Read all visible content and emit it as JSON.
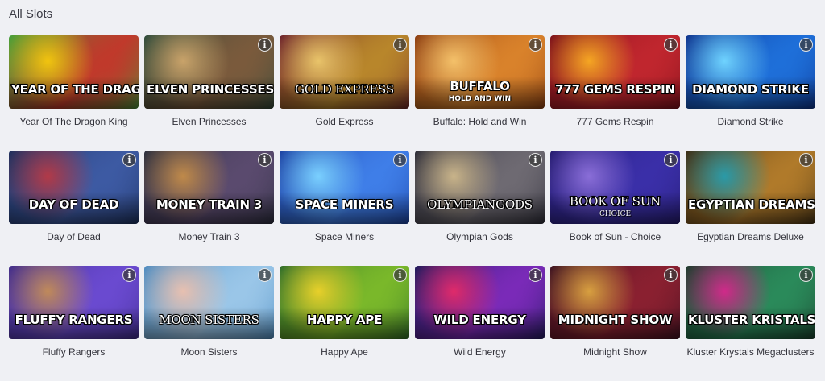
{
  "section": {
    "title": "All Slots"
  },
  "info_icon": "info-icon",
  "games": [
    {
      "name": "Year Of The Dragon King",
      "art": "YEAR OF THE DRAGON KING",
      "sub": "",
      "colors": [
        "#3f9e3a",
        "#c0392b",
        "#f1c40f"
      ]
    },
    {
      "name": "Elven Princesses",
      "art": "ELVEN PRINCESSES",
      "sub": "",
      "colors": [
        "#2c4a3a",
        "#7a5a3c",
        "#c9a36a"
      ]
    },
    {
      "name": "Gold Express",
      "art": "GOLD EXPRESS",
      "sub": "",
      "colors": [
        "#6a1f2a",
        "#b8862b",
        "#e9c46a"
      ]
    },
    {
      "name": "Buffalo: Hold and Win",
      "art": "BUFFALO",
      "sub": "HOLD AND WIN",
      "colors": [
        "#8a3b10",
        "#d9822b",
        "#f4c16a"
      ]
    },
    {
      "name": "777 Gems Respin",
      "art": "777 GEMS RESPIN",
      "sub": "",
      "colors": [
        "#7a0f1a",
        "#c0262e",
        "#f5a623"
      ]
    },
    {
      "name": "Diamond Strike",
      "art": "DIAMOND STRIKE",
      "sub": "",
      "colors": [
        "#0b2f8a",
        "#1e6fd9",
        "#6fd3ff"
      ]
    },
    {
      "name": "Day of Dead",
      "art": "DAY OF DEAD",
      "sub": "",
      "colors": [
        "#1b2f5c",
        "#3d5aa3",
        "#b23a48"
      ]
    },
    {
      "name": "Money Train 3",
      "art": "MONEY TRAIN 3",
      "sub": "",
      "colors": [
        "#2a2e3d",
        "#5a4a6e",
        "#c08a4a"
      ]
    },
    {
      "name": "Space Miners",
      "art": "SPACE MINERS",
      "sub": "",
      "colors": [
        "#1a3fa0",
        "#3f7ee8",
        "#7ad0ff"
      ]
    },
    {
      "name": "Olympian Gods",
      "art": "OLYMPIANGODS",
      "sub": "",
      "colors": [
        "#2a2a36",
        "#6e6a72",
        "#c9b48a"
      ]
    },
    {
      "name": "Book of Sun - Choice",
      "art": "BOOK OF SUN",
      "sub": "CHOICE",
      "colors": [
        "#241a6e",
        "#3a2fa8",
        "#8a6ed8"
      ]
    },
    {
      "name": "Egyptian Dreams Deluxe",
      "art": "EGYPTIAN DREAMS",
      "sub": "",
      "colors": [
        "#3a2a12",
        "#b07a2a",
        "#2a9aa8"
      ]
    },
    {
      "name": "Fluffy Rangers",
      "art": "FLUFFY RANGERS",
      "sub": "",
      "colors": [
        "#3e2a8a",
        "#6a4ad0",
        "#c08a5a"
      ]
    },
    {
      "name": "Moon Sisters",
      "art": "MOON SISTERS",
      "sub": "",
      "colors": [
        "#4a8ac0",
        "#9ac6e8",
        "#e8c0b0"
      ]
    },
    {
      "name": "Happy Ape",
      "art": "HAPPY APE",
      "sub": "",
      "colors": [
        "#2a6a2a",
        "#7ab82a",
        "#e8d02a"
      ]
    },
    {
      "name": "Wild Energy",
      "art": "WILD ENERGY",
      "sub": "",
      "colors": [
        "#1a1a5a",
        "#7a2ab8",
        "#e02a6a"
      ]
    },
    {
      "name": "Midnight Show",
      "art": "MIDNIGHT SHOW",
      "sub": "",
      "colors": [
        "#3a1020",
        "#8a2030",
        "#d8a040"
      ]
    },
    {
      "name": "Kluster Krystals Megaclusters",
      "art": "KLUSTER KRISTALS",
      "sub": "",
      "colors": [
        "#1a3a2a",
        "#2a8a5a",
        "#d02a8a"
      ]
    }
  ]
}
